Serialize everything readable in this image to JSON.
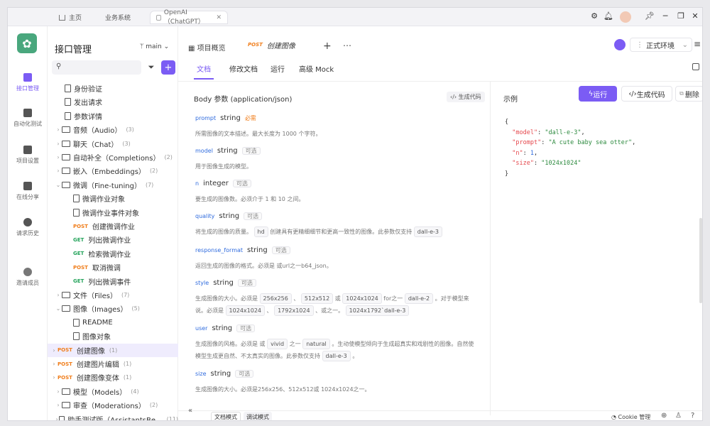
{
  "tabs": [
    {
      "label": "主页"
    },
    {
      "label": "业务系统"
    },
    {
      "label": "OpenAI（ChatGPT）"
    }
  ],
  "app": {
    "title": "接口管理",
    "branch": "main"
  },
  "nav": [
    {
      "label": "接口管理"
    },
    {
      "label": "自动化测试"
    },
    {
      "label": "项目设置"
    },
    {
      "label": "在线分享"
    },
    {
      "label": "请求历史"
    },
    {
      "label": "邀请成员"
    }
  ],
  "tree": [
    {
      "kind": "doc",
      "label": "身份验证"
    },
    {
      "kind": "doc",
      "label": "发出请求"
    },
    {
      "kind": "doc",
      "label": "参数详情"
    },
    {
      "kind": "folder",
      "label": "音频（Audio）",
      "count": "(3)"
    },
    {
      "kind": "folder",
      "label": "聊天（Chat）",
      "count": "(3)"
    },
    {
      "kind": "folder",
      "label": "自动补全（Completions）",
      "count": "(2)"
    },
    {
      "kind": "folder",
      "label": "嵌入（Embeddings）",
      "count": "(2)"
    },
    {
      "kind": "folder-open",
      "label": "微调（Fine-tuning）",
      "count": "(7)"
    },
    {
      "kind": "doc2",
      "label": "微调作业对象"
    },
    {
      "kind": "doc2",
      "label": "微调作业事件对象"
    },
    {
      "kind": "api",
      "method": "POST",
      "label": "创建微调作业"
    },
    {
      "kind": "api",
      "method": "GET",
      "label": "列出微调作业"
    },
    {
      "kind": "api",
      "method": "GET",
      "label": "检索微调作业"
    },
    {
      "kind": "api",
      "method": "POST",
      "label": "取消微调"
    },
    {
      "kind": "api",
      "method": "GET",
      "label": "列出微调事件"
    },
    {
      "kind": "folder",
      "label": "文件（Files）",
      "count": "(7)"
    },
    {
      "kind": "folder-open",
      "label": "图像（Images）",
      "count": "(5)"
    },
    {
      "kind": "doc2",
      "label": "README"
    },
    {
      "kind": "doc2",
      "label": "图像对象"
    },
    {
      "kind": "api2",
      "method": "POST",
      "label": "创建图像",
      "count": "(1)",
      "selected": true
    },
    {
      "kind": "api2",
      "method": "POST",
      "label": "创建图片编辑",
      "count": "(1)"
    },
    {
      "kind": "api2",
      "method": "POST",
      "label": "创建图像变体",
      "count": "(1)"
    },
    {
      "kind": "folder",
      "label": "模型（Models）",
      "count": "(4)"
    },
    {
      "kind": "folder",
      "label": "审查（Moderations）",
      "count": "(2)"
    },
    {
      "kind": "folder",
      "label": "助手测试版（AssistantsBe...",
      "count": "(11)"
    }
  ],
  "doctabs": {
    "overview": "项目概览",
    "current_method": "POST",
    "current": "创建图像"
  },
  "env": "正式环境",
  "subtabs": [
    {
      "label": "文档"
    },
    {
      "label": "修改文档"
    },
    {
      "label": "运行"
    },
    {
      "label": "高级 Mock"
    }
  ],
  "body": {
    "title": "Body 参数 (application/json)",
    "gen_code": "生成代码"
  },
  "params": [
    {
      "name": "prompt",
      "type": "string",
      "badge": "必需",
      "req": true,
      "desc": [
        "所需图像的文本描述。最大长度为 1000 个字符。"
      ]
    },
    {
      "name": "model",
      "type": "string",
      "badge": "可选",
      "desc": [
        "用于图像生成的模型。"
      ]
    },
    {
      "name": "n",
      "type": "integer",
      "badge": "可选",
      "desc": [
        "要生成的图像数。必须介于 1 和 10 之间。"
      ]
    },
    {
      "name": "quality",
      "type": "string",
      "badge": "可选",
      "desc": [
        "将生成的图像的质量。",
        "hd",
        "创建具有更精细细节和更高一致性的图像。此参数仅支持",
        "dall-e-3"
      ]
    },
    {
      "name": "response_format",
      "type": "string",
      "badge": "可选",
      "desc": [
        "返回生成的图像的格式。必须是 或url之一b64_json。"
      ]
    },
    {
      "name": "style",
      "type": "string",
      "badge": "可选",
      "desc": [
        "生成图像的大小。必须是",
        "256x256",
        "、",
        "512x512",
        "或",
        "1024x1024",
        "for之一",
        "dall-e-2",
        "。对于模型来说。必须是",
        "1024x1024",
        "、",
        "1792x1024",
        "、或之一。",
        "1024x1792`dall-e-3"
      ]
    },
    {
      "name": "user",
      "type": "string",
      "badge": "可选",
      "desc": [
        "生成图像的风格。必须是 或",
        "vivid",
        "之一",
        "natural",
        "。生动使模型倾向于生成超真实和戏剧性的图像。自然使模型生成更自然、不太真实的图像。此参数仅支持",
        "dall-e-3",
        "。"
      ]
    },
    {
      "name": "size",
      "type": "string",
      "badge": "可选",
      "desc": [
        "生成图像的大小。必须是256x256、512x512或 1024x1024之一。"
      ]
    }
  ],
  "example": {
    "title": "示例",
    "run": "运行",
    "gen_code": "生成代码",
    "delete": "删除",
    "lines": [
      {
        "k": "",
        "v": "{"
      },
      {
        "k": "\"model\"",
        "v": "\"dall-e-3\"",
        "c": ","
      },
      {
        "k": "\"prompt\"",
        "v": "\"A cute baby sea otter\"",
        "c": ","
      },
      {
        "k": "\"n\"",
        "v": "1",
        "c": ",",
        "num": true
      },
      {
        "k": "\"size\"",
        "v": "\"1024x1024\"",
        "c": ""
      },
      {
        "k": "",
        "v": "}"
      }
    ]
  },
  "footer": {
    "doc_mode": "文档模式",
    "debug_mode": "调试模式",
    "cookie": "Cookie 管理"
  },
  "colors": {
    "accent": "#7b5cf4",
    "post": "#f07d1a",
    "get": "#23a35a",
    "link": "#2f6bde"
  }
}
